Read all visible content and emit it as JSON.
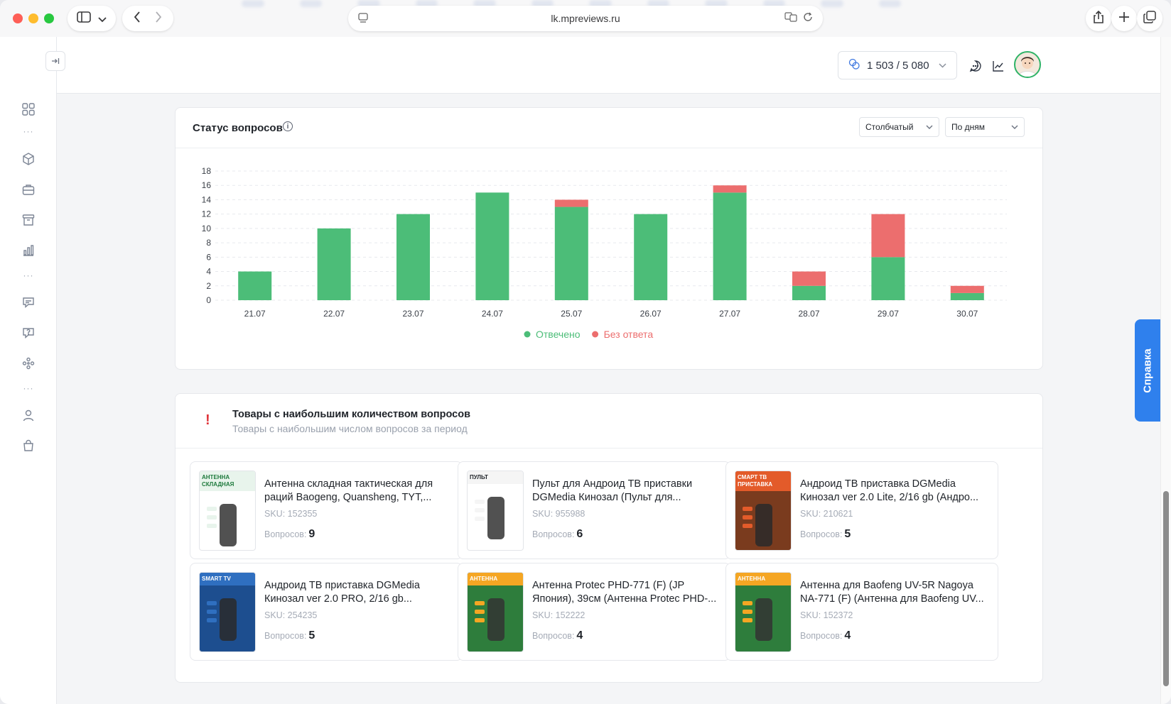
{
  "browser": {
    "url": "lk.mpreviews.ru"
  },
  "header": {
    "quota": "1 503 / 5 080"
  },
  "help_tab": "Справка",
  "status_card": {
    "title": "Статус вопросов",
    "chart_type_select": "Столбчатый",
    "period_select": "По дням"
  },
  "chart_data": {
    "type": "bar",
    "stacked": true,
    "categories": [
      "21.07",
      "22.07",
      "23.07",
      "24.07",
      "25.07",
      "26.07",
      "27.07",
      "28.07",
      "29.07",
      "30.07"
    ],
    "series": [
      {
        "name": "Отвечено",
        "color": "#4cbd78",
        "values": [
          4,
          10,
          12,
          15,
          13,
          12,
          15,
          2,
          6,
          1
        ]
      },
      {
        "name": "Без ответа",
        "color": "#ec6e6e",
        "values": [
          0,
          0,
          0,
          0,
          1,
          0,
          1,
          2,
          6,
          1
        ]
      }
    ],
    "ylim": [
      0,
      18
    ],
    "yticks": [
      0,
      2,
      4,
      6,
      8,
      10,
      12,
      14,
      16,
      18
    ],
    "grid": true,
    "legend": "bottom-center"
  },
  "products_card": {
    "title": "Товары с наибольшим количеством вопросов",
    "subtitle": "Товары с наибольшим числом вопросов за период",
    "sku_label": "SKU:",
    "questions_label": "Вопросов:",
    "items": [
      {
        "name": "Антенна складная тактическая для раций Baogeng, Quansheng, TYT,...",
        "sku": "152355",
        "questions": "9",
        "thumb_text": "АНТЕННА СКЛАДНАЯ"
      },
      {
        "name": "Пульт для Андроид ТВ приставки DGMedia Кинозал (Пульт для...",
        "sku": "955988",
        "questions": "6",
        "thumb_text": "ПУЛЬТ"
      },
      {
        "name": "Андроид ТВ приставка DGMedia Кинозал ver 2.0 Lite, 2/16 gb (Андро...",
        "sku": "210621",
        "questions": "5",
        "thumb_text": "СМАРТ ТВ ПРИСТАВКА"
      },
      {
        "name": "Андроид ТВ приставка DGMedia Кинозал ver 2.0 PRO, 2/16 gb...",
        "sku": "254235",
        "questions": "5",
        "thumb_text": "SMART TV"
      },
      {
        "name": "Антенна Protec PHD-771 (F) (JP Япония), 39см (Антенна Protec PHD-...",
        "sku": "152222",
        "questions": "4",
        "thumb_text": "АНТЕННА"
      },
      {
        "name": "Антенна для Baofeng UV-5R Nagoya NA-771 (F) (Антенна для Baofeng UV...",
        "sku": "152372",
        "questions": "4",
        "thumb_text": "АНТЕННА"
      }
    ]
  }
}
